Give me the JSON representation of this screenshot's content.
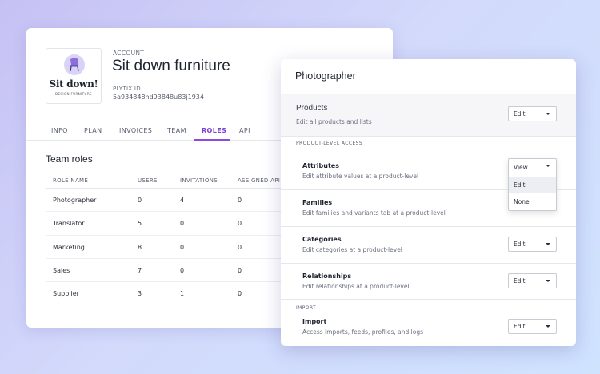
{
  "account": {
    "label": "ACCOUNT",
    "name": "Sit down furniture",
    "logo_title": "Sit down!",
    "logo_subtitle": "DESIGN FURNITURE",
    "plytix_label": "PLYTIX ID",
    "plytix_id": "5a934848hd93848u83j1934"
  },
  "tabs": [
    "INFO",
    "PLAN",
    "INVOICES",
    "TEAM",
    "ROLES",
    "API"
  ],
  "active_tab": "ROLES",
  "team_roles": {
    "title": "Team roles",
    "columns": [
      "ROLE NAME",
      "USERS",
      "INVITATIONS",
      "ASSIGNED API"
    ],
    "rows": [
      {
        "name": "Photographer",
        "users": "0",
        "invitations": "4",
        "assigned_api": "0"
      },
      {
        "name": "Translator",
        "users": "5",
        "invitations": "0",
        "assigned_api": "0"
      },
      {
        "name": "Marketing",
        "users": "8",
        "invitations": "0",
        "assigned_api": "0"
      },
      {
        "name": "Sales",
        "users": "7",
        "invitations": "0",
        "assigned_api": "0"
      },
      {
        "name": "Supplier",
        "users": "3",
        "invitations": "1",
        "assigned_api": "0"
      }
    ]
  },
  "role_panel": {
    "title": "Photographer",
    "products": {
      "title": "Products",
      "description": "Edit all products and lists",
      "value": "Edit"
    },
    "product_level_label": "PRODUCT-LEVEL ACCESS",
    "attributes": {
      "title": "Attributes",
      "description": "Edit attribute values at a product-level",
      "value": "View"
    },
    "dropdown_options": [
      "Edit",
      "None"
    ],
    "families": {
      "title": "Families",
      "description": "Edit families and variants tab at a product-level"
    },
    "categories": {
      "title": "Categories",
      "description": "Edit categories at a product-level",
      "value": "Edit"
    },
    "relationships": {
      "title": "Relationships",
      "description": "Edit relationships at a product-level",
      "value": "Edit"
    },
    "import_label": "IMPORT",
    "import": {
      "title": "Import",
      "description": "Access imports, feeds, profiles, and logs",
      "value": "Edit"
    }
  },
  "colors": {
    "accent": "#8b4be3",
    "background_start": "#c6c1f4",
    "background_end": "#cfe3ff"
  }
}
